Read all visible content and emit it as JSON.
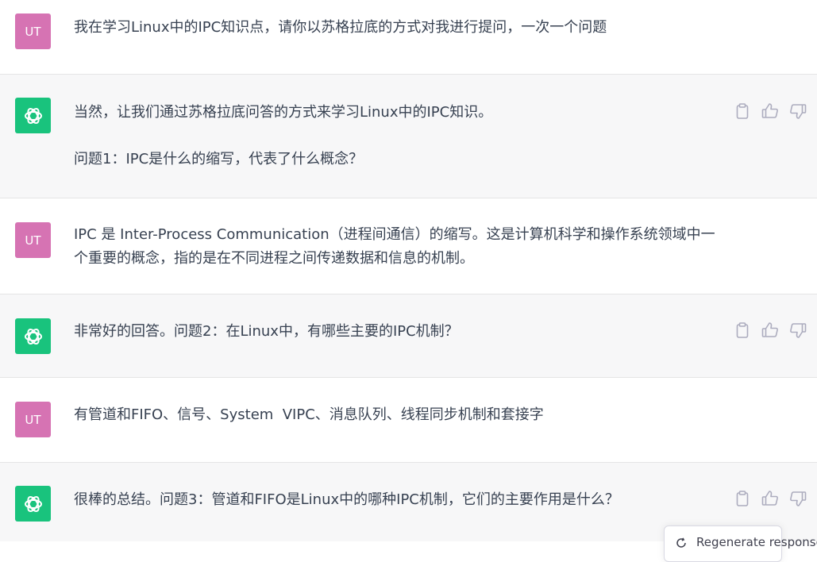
{
  "user_avatar": "UT",
  "messages": [
    {
      "role": "user",
      "lines": [
        "我在学习Linux中的IPC知识点，请你以苏格拉底的方式对我进行提问，一次一个问题"
      ]
    },
    {
      "role": "assistant",
      "lines": [
        "当然，让我们通过苏格拉底问答的方式来学习Linux中的IPC知识。",
        "问题1：IPC是什么的缩写，代表了什么概念？"
      ]
    },
    {
      "role": "user",
      "lines": [
        "IPC 是 Inter-Process Communication（进程间通信）的缩写。这是计算机科学和操作系统领域中一个重要的概念，指的是在不同进程之间传递数据和信息的机制。"
      ]
    },
    {
      "role": "assistant",
      "lines": [
        "非常好的回答。问题2：在Linux中，有哪些主要的IPC机制？"
      ]
    },
    {
      "role": "user",
      "lines": [
        "有管道和FIFO、信号、System  VIPC、消息队列、线程同步机制和套接字"
      ]
    },
    {
      "role": "assistant",
      "lines": [
        "很棒的总结。问题3：管道和FIFO是Linux中的哪种IPC机制，它们的主要作用是什么？"
      ]
    }
  ],
  "actions": {
    "copy_icon": "clipboard-icon",
    "like_icon": "thumbs-up-icon",
    "dislike_icon": "thumbs-down-icon"
  },
  "regenerate_label": "Regenerate response",
  "colors": {
    "user_avatar": "#d673b3",
    "assistant_avatar": "#19c37d",
    "assistant_bg": "#f7f7f8",
    "text": "#374151"
  }
}
